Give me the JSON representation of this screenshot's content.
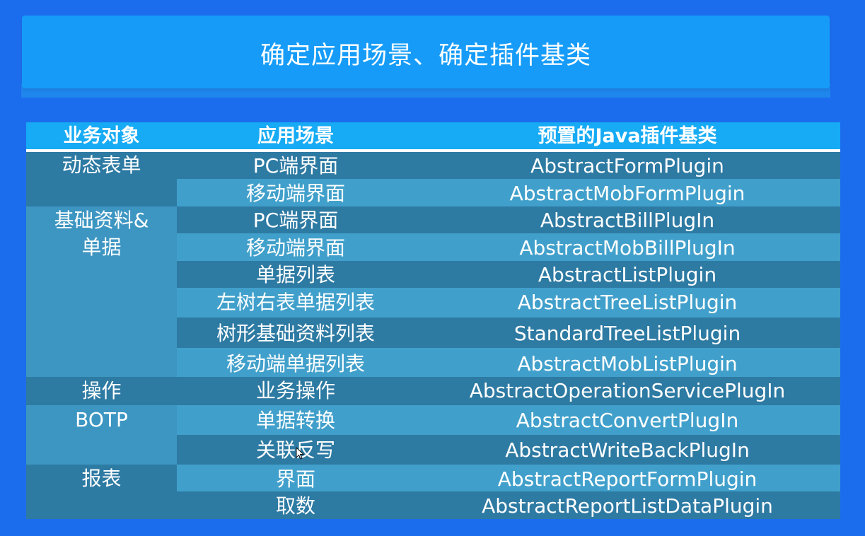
{
  "slide": {
    "title": "确定应用场景、确定插件基类"
  },
  "table": {
    "headers": [
      "业务对象",
      "应用场景",
      "预置的Java插件基类"
    ],
    "groups": [
      {
        "label": "动态表单",
        "label2": ""
      },
      {
        "label": "基础资料&",
        "label2": "单据"
      },
      {
        "label": "操作",
        "label2": ""
      },
      {
        "label": "BOTP",
        "label2": ""
      },
      {
        "label": "报表",
        "label2": ""
      }
    ],
    "rows": [
      {
        "scene": "PC端界面",
        "plugin": "AbstractFormPlugin"
      },
      {
        "scene": "移动端界面",
        "plugin": "AbstractMobFormPlugin"
      },
      {
        "scene": "PC端界面",
        "plugin": "AbstractBillPlugIn"
      },
      {
        "scene": "移动端界面",
        "plugin": "AbstractMobBillPlugIn"
      },
      {
        "scene": "单据列表",
        "plugin": "AbstractListPlugin"
      },
      {
        "scene": "左树右表单据列表",
        "plugin": "AbstractTreeListPlugin"
      },
      {
        "scene": "树形基础资料列表",
        "plugin": "StandardTreeListPlugin"
      },
      {
        "scene": "移动端单据列表",
        "plugin": "AbstractMobListPlugin"
      },
      {
        "scene": "业务操作",
        "plugin": "AbstractOperationServicePlugIn"
      },
      {
        "scene": "单据转换",
        "plugin": "AbstractConvertPlugIn"
      },
      {
        "scene": "关联反写",
        "plugin": "AbstractWriteBackPlugIn"
      },
      {
        "scene": "界面",
        "plugin": "AbstractReportFormPlugin"
      },
      {
        "scene": "取数",
        "plugin": "AbstractReportListDataPlugin"
      }
    ]
  },
  "icons": {
    "cursor": "mouse-pointer-icon"
  }
}
